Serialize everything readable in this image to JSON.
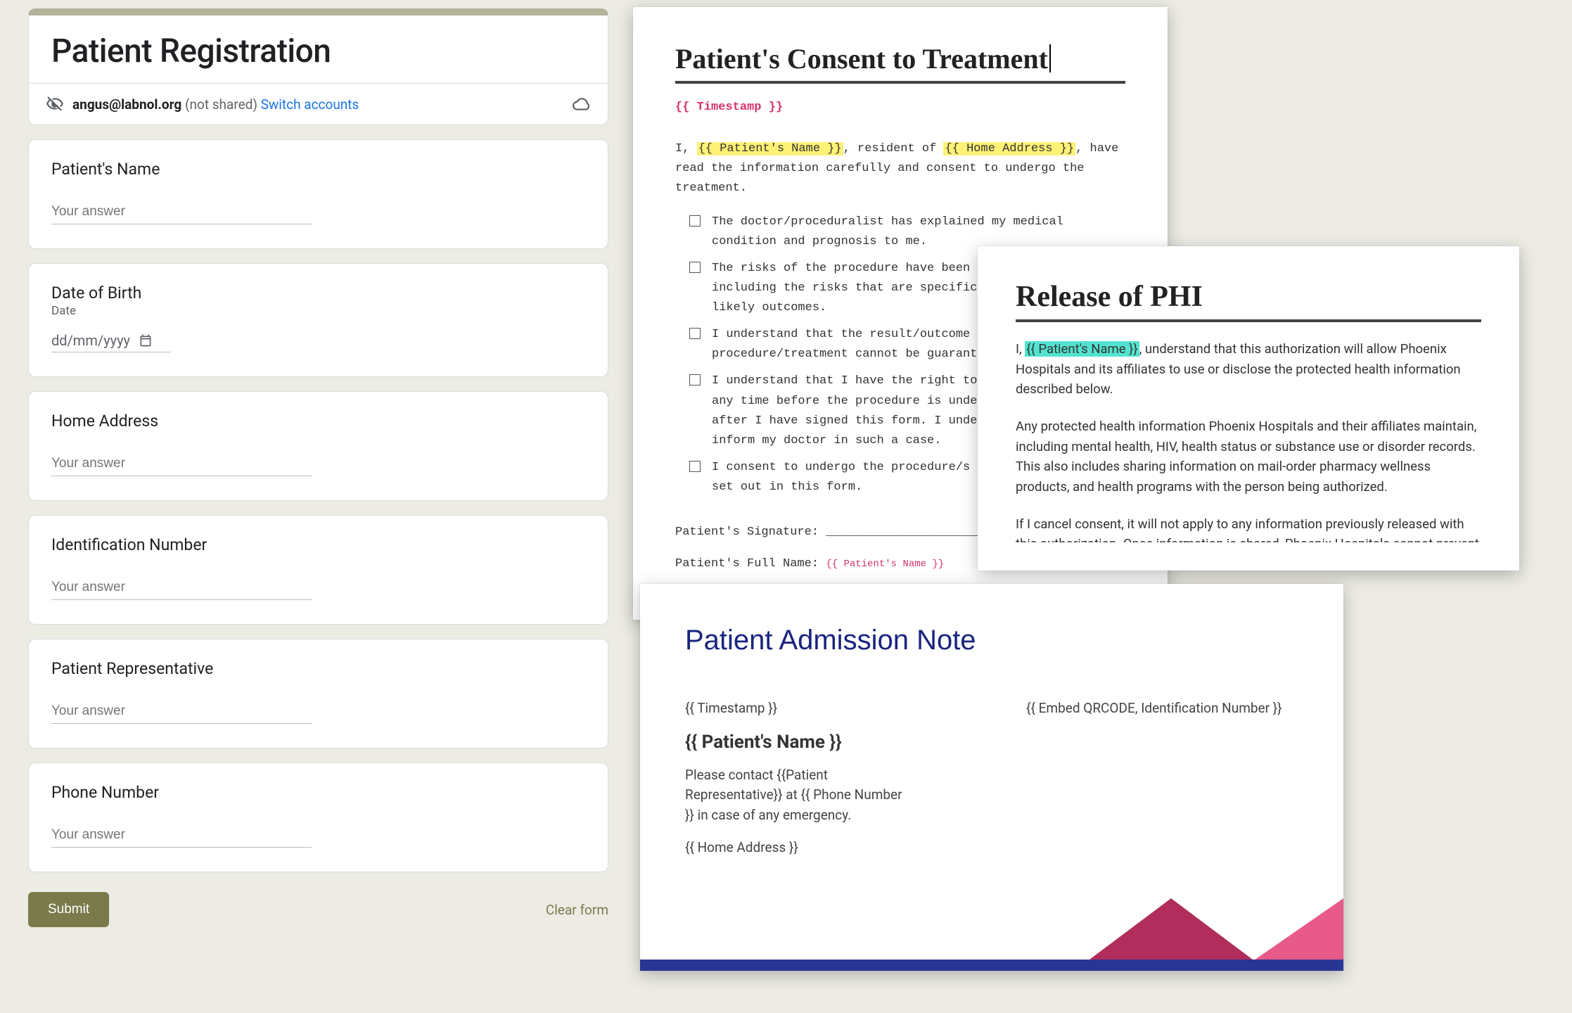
{
  "form": {
    "title": "Patient Registration",
    "account": {
      "email": "angus@labnol.org",
      "notShared": "(not shared)",
      "switch": "Switch accounts"
    },
    "questions": {
      "name": {
        "label": "Patient's Name",
        "placeholder": "Your answer"
      },
      "dob": {
        "label": "Date of Birth",
        "sub": "Date",
        "placeholder": "dd/mm/yyyy"
      },
      "addr": {
        "label": "Home Address",
        "placeholder": "Your answer"
      },
      "id": {
        "label": "Identification Number",
        "placeholder": "Your answer"
      },
      "rep": {
        "label": "Patient Representative",
        "placeholder": "Your answer"
      },
      "phone": {
        "label": "Phone Number",
        "placeholder": "Your answer"
      }
    },
    "submit": "Submit",
    "clear": "Clear form"
  },
  "docs": {
    "consent": {
      "title": "Patient's Consent to Treatment",
      "timestamp": "{{ Timestamp }}",
      "leadA": "I, ",
      "tagPatient": "{{ Patient's Name }}",
      "leadB": ", resident of ",
      "tagAddr": "{{ Home Address }}",
      "leadC": ", have read the information carefully and consent to undergo the treatment.",
      "items": [
        "The doctor/proceduralist has explained my medical condition and prognosis to me.",
        "The risks of the procedure have been explained to me, including the risks that are specific to me and the likely outcomes.",
        "I understand that the result/outcome of the procedure/treatment cannot be guaranteed.",
        "I understand that I have the right to change my mind at any time before the procedure is undertaken, including after I have signed this form. I understand that I must inform my doctor in such a case.",
        "I consent to undergo the procedure/s or treatment/s as set out in this form."
      ],
      "sig": "Patient's Signature: ________________________________________",
      "nameLine": "Patient's Full Name: ",
      "nameTag": "{{ Patient's Name }}"
    },
    "phi": {
      "title": "Release of PHI",
      "p1a": "I, ",
      "p1tag": "{{ Patient's Name }}",
      "p1b": ", understand that this authorization will allow Phoenix Hospitals and its affiliates to use or disclose the protected health information described below.",
      "p2": "Any protected health information Phoenix Hospitals and their affiliates maintain, including mental health, HIV, health status or substance use or disorder records. This also includes sharing information on mail-order pharmacy wellness products, and health programs with the person being authorized.",
      "p3": "If I cancel consent, it will not apply to any information previously released with this authorization. Once information is shared, Phoenix Hospitals cannot prevent the person or organization who has access to it from sharing that information with others, and this information may not be protected by federal privacy regulations."
    },
    "adm": {
      "title": "Patient Admission Note",
      "ts": "{{ Timestamp }}",
      "qr": "{{ Embed QRCODE, Identification Number }}",
      "name": "{{ Patient's Name }}",
      "contact": "Please contact {{Patient Representative}} at {{ Phone Number }} in case of any emergency.",
      "addr": "{{ Home Address }}"
    }
  }
}
